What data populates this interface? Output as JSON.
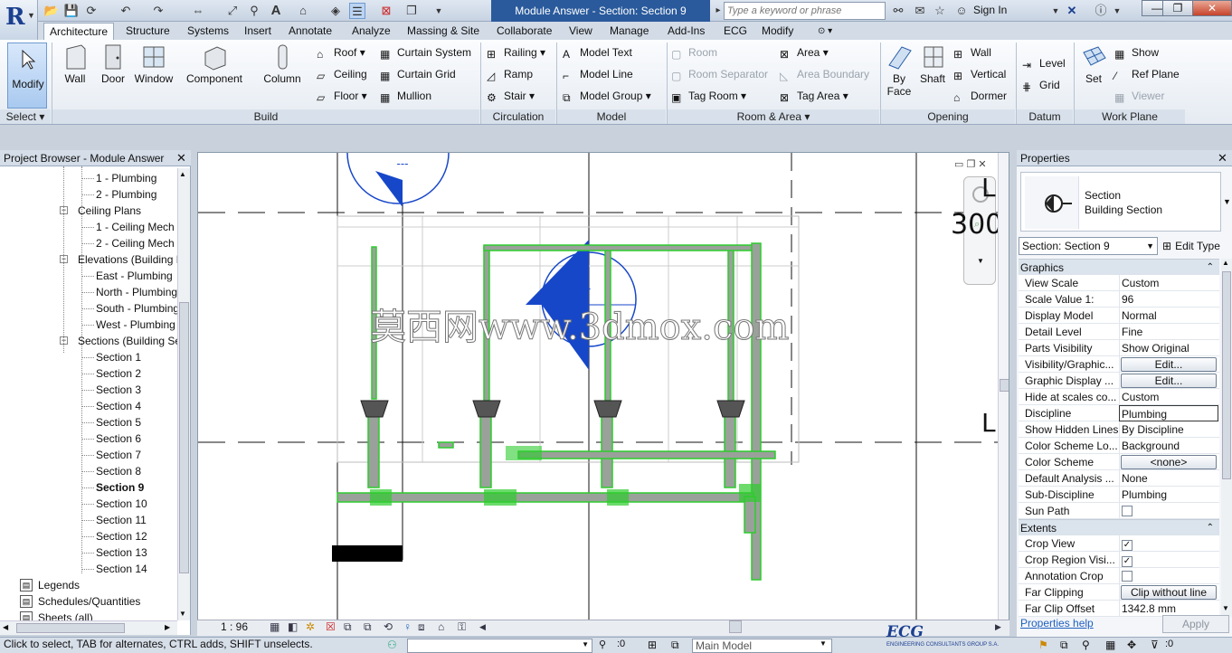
{
  "app": {
    "title": "Module Answer - Section: Section 9",
    "search_placeholder": "Type a keyword or phrase",
    "sign_in": "Sign In",
    "logo_letter": "R"
  },
  "tabs": [
    "Architecture",
    "Structure",
    "Systems",
    "Insert",
    "Annotate",
    "Analyze",
    "Massing & Site",
    "Collaborate",
    "View",
    "Manage",
    "Add-Ins",
    "ECG",
    "Modify"
  ],
  "ribbon": {
    "select": {
      "modify": "Modify",
      "title": "Select"
    },
    "build": {
      "title": "Build",
      "big": [
        "Wall",
        "Door",
        "Window",
        "Component",
        "Column"
      ],
      "small": [
        "Roof",
        "Ceiling",
        "Floor",
        "Curtain System",
        "Curtain Grid",
        "Mullion"
      ]
    },
    "circulation": {
      "title": "Circulation",
      "items": [
        "Railing",
        "Ramp",
        "Stair"
      ]
    },
    "model": {
      "title": "Model",
      "items": [
        "Model Text",
        "Model Line",
        "Model Group"
      ]
    },
    "room_area": {
      "title": "Room & Area",
      "items": [
        "Room",
        "Room Separator",
        "Tag Room",
        "Area",
        "Area Boundary",
        "Tag Area"
      ]
    },
    "opening": {
      "title": "Opening",
      "big": [
        "By Face",
        "Shaft"
      ],
      "small": [
        "Wall",
        "Vertical",
        "Dormer"
      ]
    },
    "datum": {
      "title": "Datum",
      "items": [
        "Level",
        "Grid"
      ]
    },
    "work_plane": {
      "title": "Work Plane",
      "big": "Set",
      "small": [
        "Show",
        "Ref  Plane",
        "Viewer"
      ]
    }
  },
  "project_browser": {
    "title": "Project Browser - Module Answer",
    "rows": [
      {
        "label": "1 - Plumbing",
        "level": 3
      },
      {
        "label": "2 - Plumbing",
        "level": 3
      },
      {
        "label": "Ceiling Plans",
        "level": 2,
        "expander": "−"
      },
      {
        "label": "1 - Ceiling Mech",
        "level": 3
      },
      {
        "label": "2 - Ceiling Mech",
        "level": 3
      },
      {
        "label": "Elevations (Building Elevation)",
        "level": 2,
        "expander": "−"
      },
      {
        "label": "East - Plumbing",
        "level": 3
      },
      {
        "label": "North - Plumbing",
        "level": 3
      },
      {
        "label": "South - Plumbing",
        "level": 3
      },
      {
        "label": "West - Plumbing",
        "level": 3
      },
      {
        "label": "Sections (Building Section)",
        "level": 2,
        "expander": "−"
      },
      {
        "label": "Section 1",
        "level": 3
      },
      {
        "label": "Section 2",
        "level": 3
      },
      {
        "label": "Section 3",
        "level": 3
      },
      {
        "label": "Section 4",
        "level": 3
      },
      {
        "label": "Section 5",
        "level": 3
      },
      {
        "label": "Section 6",
        "level": 3
      },
      {
        "label": "Section 7",
        "level": 3
      },
      {
        "label": "Section 8",
        "level": 3
      },
      {
        "label": "Section 9",
        "level": 3,
        "bold": true
      },
      {
        "label": "Section 10",
        "level": 3
      },
      {
        "label": "Section 11",
        "level": 3
      },
      {
        "label": "Section 12",
        "level": 3
      },
      {
        "label": "Section 13",
        "level": 3
      },
      {
        "label": "Section 14",
        "level": 3
      },
      {
        "label": "Legends",
        "level": 1,
        "icon": true
      },
      {
        "label": "Schedules/Quantities",
        "level": 1,
        "icon": true
      },
      {
        "label": "Sheets (all)",
        "level": 1,
        "icon": true
      }
    ]
  },
  "canvas": {
    "watermark": "莫西网www.3dmox.com",
    "elevation_label": "300",
    "section_mark": "---",
    "dash": "-",
    "level_glyph": "L"
  },
  "view_bar": {
    "scale": "1 : 96"
  },
  "properties": {
    "title": "Properties",
    "type_name": "Section",
    "type_sub": "Building Section",
    "selector": "Section: Section 9",
    "edit_type": "Edit Type",
    "groups": [
      {
        "name": "Graphics",
        "rows": [
          {
            "k": "View Scale",
            "v": "Custom"
          },
          {
            "k": "Scale Value    1:",
            "v": "96"
          },
          {
            "k": "Display Model",
            "v": "Normal"
          },
          {
            "k": "Detail Level",
            "v": "Fine"
          },
          {
            "k": "Parts Visibility",
            "v": "Show Original"
          },
          {
            "k": "Visibility/Graphic...",
            "v": "Edit...",
            "kind": "button"
          },
          {
            "k": "Graphic Display ...",
            "v": "Edit...",
            "kind": "button"
          },
          {
            "k": "Hide at scales co...",
            "v": "Custom"
          },
          {
            "k": "Discipline",
            "v": "Plumbing",
            "kind": "boxed"
          },
          {
            "k": "Show Hidden Lines",
            "v": "By Discipline"
          },
          {
            "k": "Color Scheme Lo...",
            "v": "Background"
          },
          {
            "k": "Color Scheme",
            "v": "<none>",
            "kind": "button"
          },
          {
            "k": "Default Analysis ...",
            "v": "None"
          },
          {
            "k": "Sub-Discipline",
            "v": "Plumbing"
          },
          {
            "k": "Sun Path",
            "v": "",
            "kind": "check",
            "checked": false
          }
        ]
      },
      {
        "name": "Extents",
        "rows": [
          {
            "k": "Crop View",
            "v": "",
            "kind": "check",
            "checked": true
          },
          {
            "k": "Crop Region Visi...",
            "v": "",
            "kind": "check",
            "checked": true
          },
          {
            "k": "Annotation Crop",
            "v": "",
            "kind": "check",
            "checked": false
          },
          {
            "k": "Far Clipping",
            "v": "Clip without line",
            "kind": "button"
          },
          {
            "k": "Far Clip Offset",
            "v": "1342.8 mm"
          }
        ]
      }
    ],
    "help": "Properties help",
    "apply": "Apply"
  },
  "status": {
    "text": "Click to select, TAB for alternates, CTRL adds, SHIFT unselects.",
    "count": ":0",
    "model": "Main Model",
    "filter_count": ":0"
  },
  "branding": {
    "ecg": "ECG",
    "ecg_sub": "ENGINEERING CONSULTANTS GROUP S.A."
  },
  "colors": {
    "pipe": "#2dcc2d",
    "pipe_metal": "#9aa19a",
    "section_blue": "#1747c9",
    "title_blue": "#2a5a9c"
  }
}
